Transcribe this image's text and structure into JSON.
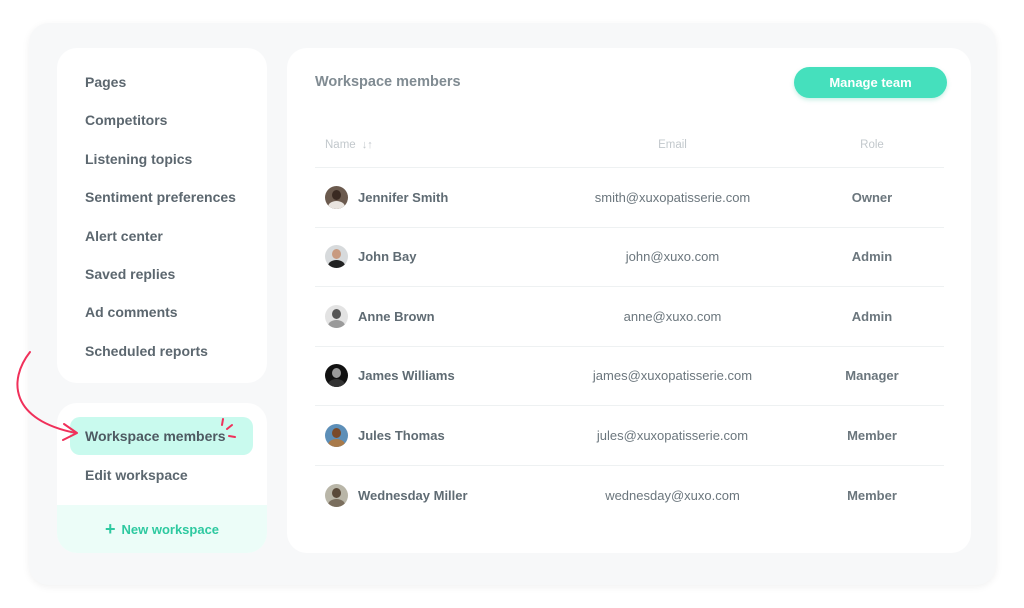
{
  "sidebar": {
    "nav_items": [
      {
        "label": "Pages"
      },
      {
        "label": "Competitors"
      },
      {
        "label": "Listening topics"
      },
      {
        "label": "Sentiment preferences"
      },
      {
        "label": "Alert center"
      },
      {
        "label": "Saved replies"
      },
      {
        "label": "Ad comments"
      },
      {
        "label": "Scheduled reports"
      }
    ],
    "workspace_items": [
      {
        "label": "Workspace members",
        "active": true
      },
      {
        "label": "Edit workspace",
        "active": false
      }
    ],
    "new_workspace": {
      "icon": "plus-icon",
      "label": "New workspace"
    }
  },
  "main": {
    "title": "Workspace members",
    "manage_button": "Manage team",
    "table": {
      "headers": {
        "name": "Name",
        "name_sort_icon": "↓↑",
        "email": "Email",
        "role": "Role"
      },
      "rows": [
        {
          "name": "Jennifer Smith",
          "email": "smith@xuxopatisserie.com",
          "role": "Owner",
          "avatar": "avatar-photo"
        },
        {
          "name": "John Bay",
          "email": "john@xuxo.com",
          "role": "Admin",
          "avatar": "avatar-photo"
        },
        {
          "name": "Anne Brown",
          "email": "anne@xuxo.com",
          "role": "Admin",
          "avatar": "avatar-photo"
        },
        {
          "name": "James Williams",
          "email": "james@xuxopatisserie.com",
          "role": "Manager",
          "avatar": "avatar-photo"
        },
        {
          "name": "Jules Thomas",
          "email": "jules@xuxopatisserie.com",
          "role": "Member",
          "avatar": "avatar-photo"
        },
        {
          "name": "Wednesday Miller",
          "email": "wednesday@xuxo.com",
          "role": "Member",
          "avatar": "avatar-photo"
        }
      ]
    }
  },
  "colors": {
    "accent": "#45e0bd",
    "accent_text": "#2ec9a0",
    "active_bg": "#c9faee",
    "annotation": "#f0305a"
  }
}
